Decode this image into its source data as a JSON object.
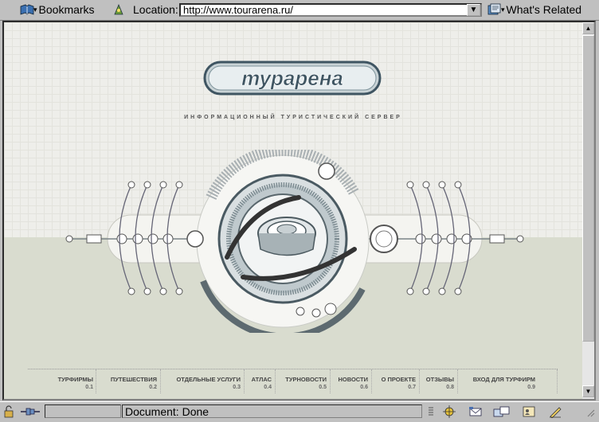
{
  "toolbar": {
    "bookmarks_label": "Bookmarks",
    "location_label": "Location:",
    "url": "http://www.tourarena.ru/",
    "whats_related_label": "What's Related"
  },
  "site": {
    "logo": "турарена",
    "tagline": "ИНФОРМАЦИОННЫЙ ТУРИСТИЧЕСКИЙ СЕРВЕР",
    "menu": [
      {
        "label": "ТУРФИРМЫ",
        "num": "0.1"
      },
      {
        "label": "ПУТЕШЕСТВИЯ",
        "num": "0.2"
      },
      {
        "label": "ОТДЕЛЬНЫЕ УСЛУГИ",
        "num": "0.3"
      },
      {
        "label": "АТЛАС",
        "num": "0.4"
      },
      {
        "label": "ТУРНОВОСТИ",
        "num": "0.5"
      },
      {
        "label": "НОВОСТИ",
        "num": "0.6"
      },
      {
        "label": "О ПРОЕКТЕ",
        "num": "0.7"
      },
      {
        "label": "ОТЗЫВЫ",
        "num": "0.8"
      },
      {
        "label": "ВХОД ДЛЯ ТУРФИРМ",
        "num": "0.9"
      }
    ]
  },
  "status": {
    "text": "Document: Done"
  },
  "colors": {
    "chrome": "#c0c0c0",
    "page_bg": "#eeeeea",
    "page_low": "#d9dccf",
    "logo_stroke": "#3f5562"
  }
}
